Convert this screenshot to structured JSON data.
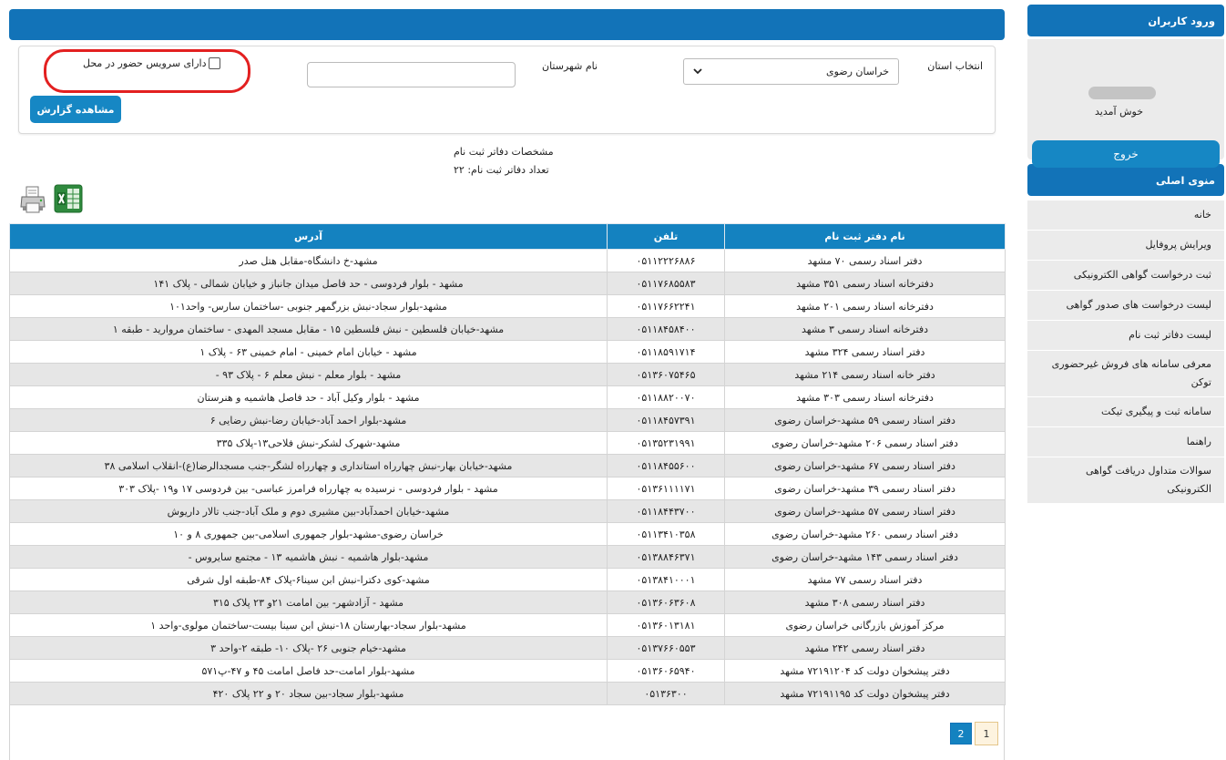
{
  "sidebar": {
    "login_header": "ورود کاربران",
    "welcome": "خوش آمدید",
    "logout": "خروج",
    "menu_header": "منوی اصلی",
    "menu": [
      "خانه",
      "ویرایش پروفایل",
      "ثبت درخواست گواهی الکترونیکی",
      "لیست درخواست های صدور گواهی",
      "لیست دفاتر ثبت نام",
      "معرفی سامانه های فروش غیرحضوری توکن",
      "سامانه ثبت و پیگیری تیکت",
      "راهنما",
      "سوالات متداول دریافت گواهی الکترونیکی"
    ]
  },
  "filters": {
    "province_label": "انتخاب استان",
    "province_value": "خراسان رضوی",
    "city_label": "نام شهرستان",
    "city_value": "",
    "onsite_label": "دارای سرویس حضور در محل",
    "onsite_checked": false,
    "report_button": "مشاهده گزارش"
  },
  "info": {
    "title": "مشخصات دفاتر ثبت نام",
    "count": "تعداد دفاتر ثبت نام: ۲۲"
  },
  "icons": {
    "print": "printer-icon",
    "export": "excel-icon"
  },
  "table": {
    "headers": [
      "نام دفتر ثبت نام",
      "تلفن",
      "آدرس"
    ],
    "rows": [
      [
        "دفتر اسناد رسمی ۷۰ مشهد",
        "۰۵۱۱۲۲۲۶۸۸۶",
        "مشهد-خ دانشگاه-مقابل هتل صدر"
      ],
      [
        "دفترخانه اسناد رسمی ۳۵۱ مشهد",
        "۰۵۱۱۷۶۸۵۵۸۳",
        "مشهد - بلوار فردوسی - حد فاصل میدان جانباز و خیابان شمالی - پلاک ۱۴۱"
      ],
      [
        "دفترخانه اسناد رسمی ۲۰۱ مشهد",
        "۰۵۱۱۷۶۶۲۲۴۱",
        "مشهد-بلوار سجاد-نبش بزرگمهر جنوبی -ساختمان سارس- واحد۱۰۱"
      ],
      [
        "دفترخانه اسناد رسمی ۳ مشهد",
        "۰۵۱۱۸۴۵۸۴۰۰",
        "مشهد-خیابان فلسطین - نبش فلسطین ۱۵ - مقابل مسجد المهدی - ساختمان مروارید - طبقه ۱"
      ],
      [
        "دفتر اسناد رسمی ۳۲۴ مشهد",
        "۰۵۱۱۸۵۹۱۷۱۴",
        "مشهد - خیابان امام خمینی - امام خمینی ۶۳ - پلاک ۱"
      ],
      [
        "دفتر خانه اسناد رسمی ۲۱۴ مشهد",
        "۰۵۱۳۶۰۷۵۴۶۵",
        "مشهد - بلوار معلم - نبش معلم ۶ - پلاک ۹۳ -"
      ],
      [
        "دفترخانه اسناد رسمی ۳۰۳ مشهد",
        "۰۵۱۱۸۸۲۰۰۷۰",
        "مشهد - بلوار وکیل آباد - حد فاصل هاشمیه و هنرستان"
      ],
      [
        "دفتر اسناد رسمی ۵۹ مشهد-خراسان رضوی",
        "۰۵۱۱۸۴۵۷۳۹۱",
        "مشهد-بلوار احمد آباد-خیابان رضا-نبش رضایی ۶"
      ],
      [
        "دفتر اسناد رسمی ۲۰۶ مشهد-خراسان رضوی",
        "۰۵۱۳۵۲۳۱۹۹۱",
        "مشهد-شهرک لشکر-نبش فلاحی۱۳-پلاک ۳۳۵"
      ],
      [
        "دفتر اسناد رسمی ۶۷ مشهد-خراسان رضوی",
        "۰۵۱۱۸۴۵۵۶۰۰",
        "مشهد-خیابان بهار-نبش چهارراه استانداری و چهارراه لشگر-جنب مسجدالرضا(ع)-انقلاب اسلامی ۳۸"
      ],
      [
        "دفتر اسناد رسمی ۳۹ مشهد-خراسان رضوی",
        "۰۵۱۳۶۱۱۱۱۷۱",
        "مشهد - بلوار فردوسی - نرسیده به چهارراه فرامرز عباسی- بین فردوسی ۱۷ و۱۹ -پلاک ۳۰۳"
      ],
      [
        "دفتر اسناد رسمی ۵۷ مشهد-خراسان رضوی",
        "۰۵۱۱۸۴۴۳۷۰۰",
        "مشهد-خیابان احمدآباد-بین مشیری دوم و ملک آباد-جنب تالار داریوش"
      ],
      [
        "دفتر اسناد رسمی ۲۶۰ مشهد-خراسان رضوی",
        "۰۵۱۱۳۴۱۰۳۵۸",
        "خراسان رضوی-مشهد-بلوار جمهوری اسلامی-بین جمهوری ۸ و ۱۰"
      ],
      [
        "دفتر اسناد رسمی ۱۴۳ مشهد-خراسان رضوی",
        "۰۵۱۳۸۸۴۶۳۷۱",
        "مشهد-بلوار هاشمیه - نبش هاشمیه ۱۳ - مجتمع سایروس -"
      ],
      [
        "دفتر اسناد رسمی ۷۷ مشهد",
        "۰۵۱۳۸۴۱۰۰۰۱",
        "مشهد-کوی دکترا-نبش ابن سینا۶-پلاک ۸۴-طبقه اول شرقی"
      ],
      [
        "دفتر اسناد رسمی ۳۰۸ مشهد",
        "۰۵۱۳۶۰۶۳۶۰۸",
        "مشهد - آزادشهر- بین امامت ۲۱و ۲۳ پلاک ۳۱۵"
      ],
      [
        "مرکز آموزش بازرگانی خراسان رضوی",
        "۰۵۱۳۶۰۱۳۱۸۱",
        "مشهد-بلوار سجاد-بهارستان ۱۸-نبش ابن سینا بیست-ساختمان مولوی-واحد ۱"
      ],
      [
        "دفتر اسناد رسمی ۲۴۲ مشهد",
        "۰۵۱۳۷۶۶۰۵۵۳",
        "مشهد-خیام جنوبی ۲۶ -پلاک ۱۰- طبقه ۲-واحد ۳"
      ],
      [
        "دفتر پیشخوان دولت کد ۷۲۱۹۱۲۰۴ مشهد",
        "۰۵۱۳۶۰۶۵۹۴۰",
        "مشهد-بلوار امامت-حد فاصل امامت ۴۵ و ۴۷-پ۵۷۱"
      ],
      [
        "دفتر پیشخوان دولت کد ۷۲۱۹۱۱۹۵ مشهد",
        "۰۵۱۳۶۳۰۰",
        "مشهد-بلوار سجاد-بین سجاد ۲۰ و ۲۲ پلاک ۴۲۰"
      ]
    ]
  },
  "pagination": {
    "pages": [
      "1",
      "2"
    ],
    "current": "1"
  },
  "colors": {
    "primary": "#1273b8",
    "button": "#1687c4",
    "highlight": "#e32020"
  }
}
